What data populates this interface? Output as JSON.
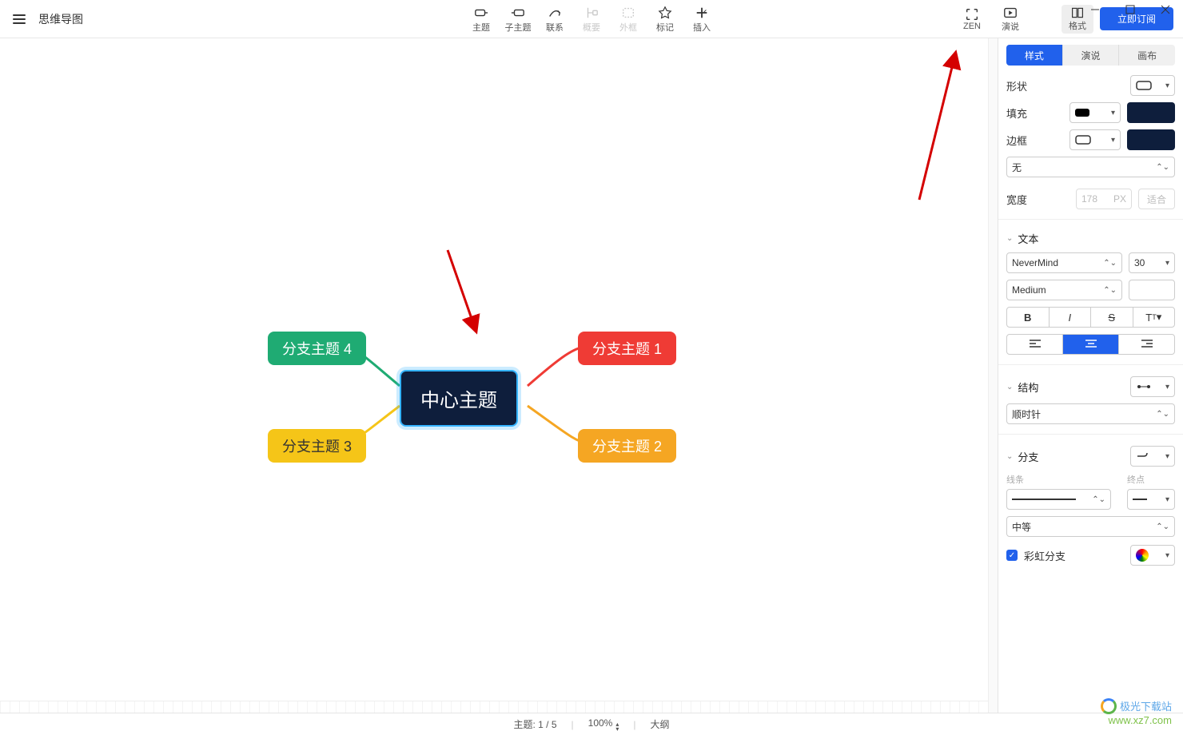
{
  "header": {
    "doc_title": "思维导图",
    "toolbar": [
      {
        "id": "topic",
        "label": "主题"
      },
      {
        "id": "subtopic",
        "label": "子主题"
      },
      {
        "id": "relation",
        "label": "联系"
      },
      {
        "id": "summary",
        "label": "概要",
        "disabled": true
      },
      {
        "id": "boundary",
        "label": "外框",
        "disabled": true
      },
      {
        "id": "marker",
        "label": "标记"
      },
      {
        "id": "insert",
        "label": "插入"
      }
    ],
    "right": [
      {
        "id": "zen",
        "label": "ZEN"
      },
      {
        "id": "pitch",
        "label": "演说"
      }
    ],
    "format_label": "格式",
    "subscribe": "立即订阅"
  },
  "panel": {
    "tabs": [
      "样式",
      "演说",
      "画布"
    ],
    "active_tab": 0,
    "shape": {
      "label": "形状"
    },
    "fill": {
      "label": "填充",
      "swatch": "#0e1e3c",
      "color": "#0e1e3c"
    },
    "border": {
      "label": "边框",
      "color": "#0e1e3c"
    },
    "border_style": "无",
    "width": {
      "label": "宽度",
      "value": "178",
      "unit": "PX",
      "fit": "适合"
    },
    "text": {
      "section": "文本",
      "font": "NeverMind",
      "size": "30",
      "weight": "Medium"
    },
    "structure": {
      "section": "结构",
      "direction": "顺时针"
    },
    "branch": {
      "section": "分支",
      "line_label": "线条",
      "end_label": "终点",
      "thickness": "中等",
      "rainbow": "彩虹分支"
    }
  },
  "mindmap": {
    "center": "中心主题",
    "b1": "分支主题 1",
    "b2": "分支主题 2",
    "b3": "分支主题 3",
    "b4": "分支主题 4"
  },
  "status": {
    "topics": "主题: 1 / 5",
    "zoom": "100%",
    "outline": "大纲"
  },
  "watermark": {
    "name": "极光下载站",
    "url": "www.xz7.com"
  }
}
